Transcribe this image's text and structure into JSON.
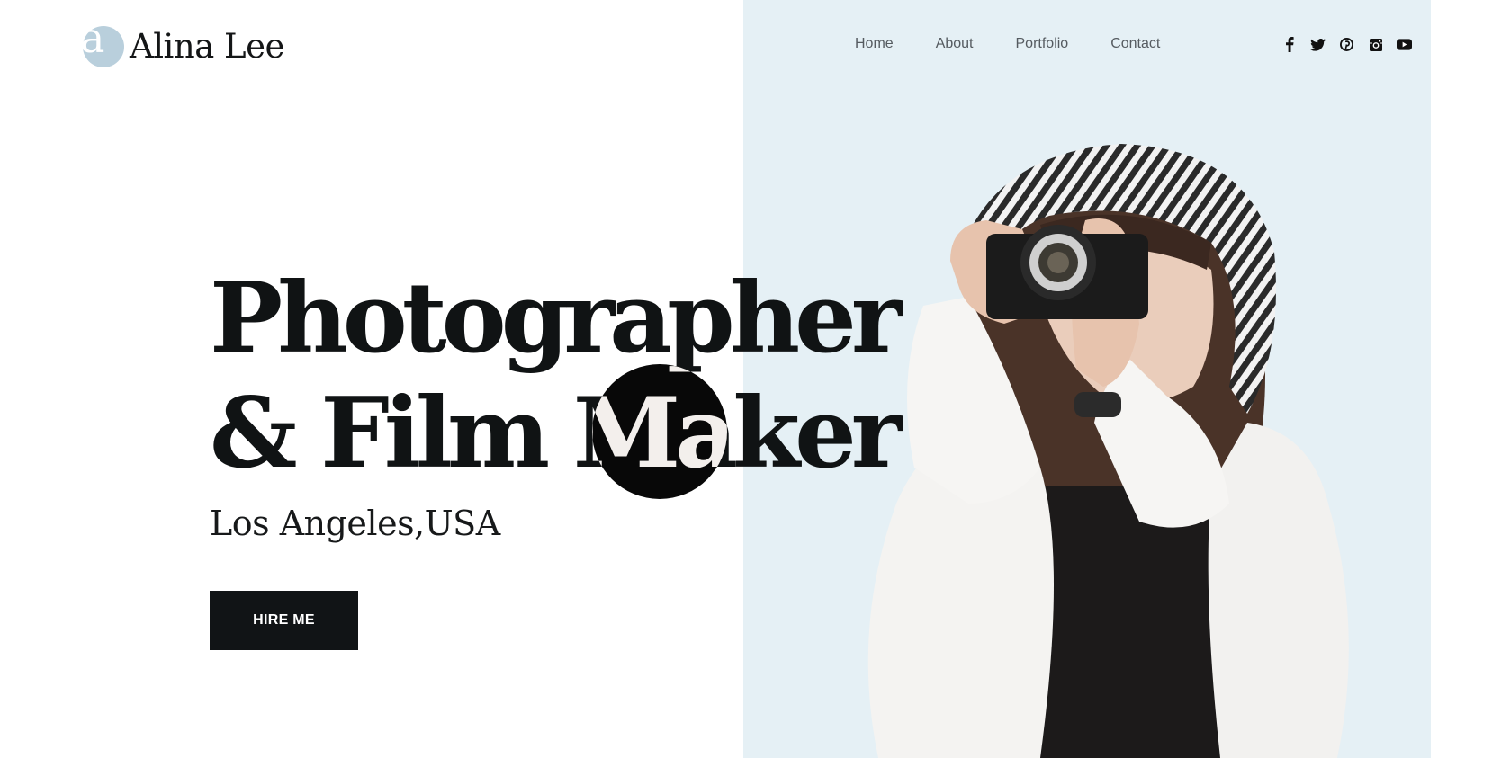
{
  "brand": {
    "logo_letter": "a",
    "name": "Alina Lee"
  },
  "nav": {
    "items": [
      {
        "label": "Home"
      },
      {
        "label": "About"
      },
      {
        "label": "Portfolio"
      },
      {
        "label": "Contact"
      }
    ]
  },
  "socials": [
    {
      "icon": "facebook-icon"
    },
    {
      "icon": "twitter-icon"
    },
    {
      "icon": "pinterest-icon"
    },
    {
      "icon": "instagram-icon"
    },
    {
      "icon": "youtube-icon"
    }
  ],
  "hero": {
    "headline_line1": "Photographer",
    "headline_line2": "& Film Maker",
    "location": "Los Angeles,USA",
    "cta_label": "HIRE ME"
  },
  "colors": {
    "accent_logo": "#b9cfdc",
    "photo_background": "#e5f0f5",
    "text_dark": "#101314",
    "button_bg": "#111416"
  }
}
